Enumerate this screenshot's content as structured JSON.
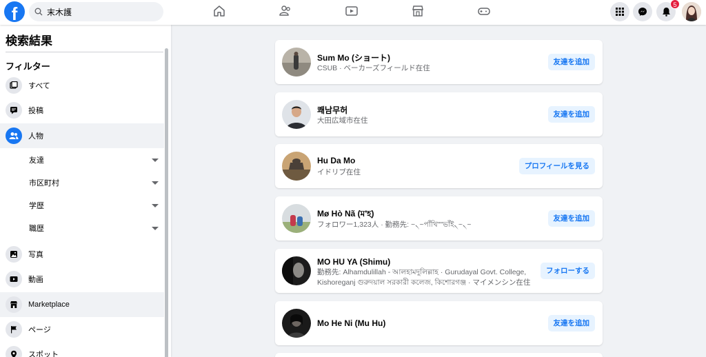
{
  "search": {
    "value": "末木護"
  },
  "notifications": {
    "count": "5"
  },
  "sidebar": {
    "title": "検索結果",
    "filter_label": "フィルター",
    "items": [
      {
        "label": "すべて",
        "icon": "all-icon"
      },
      {
        "label": "投稿",
        "icon": "posts-icon"
      },
      {
        "label": "人物",
        "icon": "people-icon"
      },
      {
        "label": "写真",
        "icon": "photos-icon"
      },
      {
        "label": "動画",
        "icon": "video-icon"
      },
      {
        "label": "Marketplace",
        "icon": "marketplace-icon"
      },
      {
        "label": "ページ",
        "icon": "flag-icon"
      },
      {
        "label": "スポット",
        "icon": "place-icon"
      }
    ],
    "sub_filters": [
      {
        "label": "友達"
      },
      {
        "label": "市区町村"
      },
      {
        "label": "学歴"
      },
      {
        "label": "職歴"
      }
    ]
  },
  "results": [
    {
      "name": "Sum Mo (ショート)",
      "meta": "CSUB · ベーカーズフィールド在住",
      "action": "友達を追加"
    },
    {
      "name": "쾌남무허",
      "meta": "大田広域市在住",
      "action": "友達を追加"
    },
    {
      "name": "Hu Da Mo",
      "meta": "イドリブ在住",
      "action": "プロフィールを見る"
    },
    {
      "name": "Mø Hò Nã (ম'হ)",
      "meta": "フォロワー1,323人 · 勤務先: ~৲~পাঁখি\"\"ভাঁই৲~৲~",
      "action": "友達を追加"
    },
    {
      "name": "MO HU YA (Shimu)",
      "meta": "勤務先: Alhamdulillah - আলহামদুলিল্লাহ · Gurudayal Govt. College, Kishoreganj গুরুদয়াল সরকারী কলেজ, কিশোরগঞ্জ · マイメンシン在住",
      "action": "フォローする"
    },
    {
      "name": "Mo He Ni (Mu Hu)",
      "meta": "",
      "action": "友達を追加"
    }
  ]
}
